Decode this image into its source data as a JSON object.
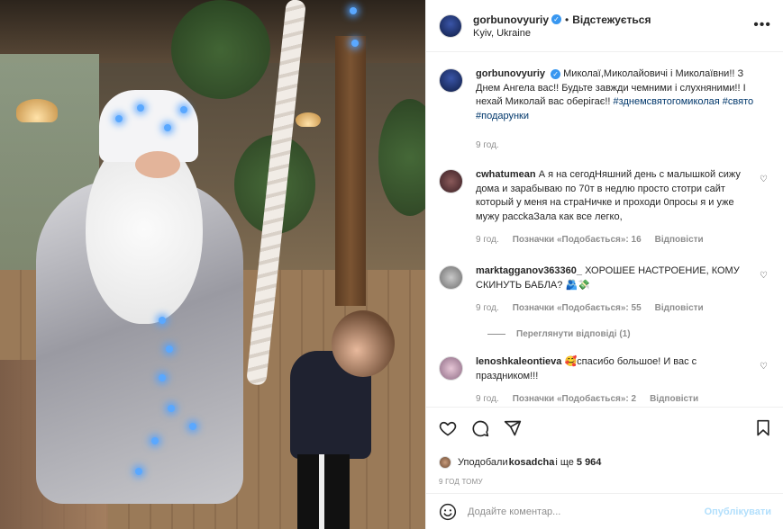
{
  "post": {
    "author": "gorbunovyuriy",
    "follow_label": "Відстежується",
    "location": "Kyiv, Ukraine"
  },
  "caption": {
    "author": "gorbunovyuriy",
    "text": "Миколаї,Миколайовичі і Миколаївни!! З Днем Ангела вас!! Будьте завжди чемними і слухняними!! І нехай Миколай вас оберігає!! ",
    "hashtags": "#зднемсвятогомиколая #свято #подарунки",
    "time": "9 год."
  },
  "comments": [
    {
      "author": "cwhatumean",
      "text": "А я на сегодНяшний день с малышкой сижу дома и зарабываю по 70т в недлю просто стотри сайт который у меня на страНичке и проходи 0просы я и уже мужу рассkаЗала как все легко,",
      "time": "9 год.",
      "likes": "Позначки «Подобається»: 16",
      "reply": "Відповісти"
    },
    {
      "author": "marktagganov363360_",
      "text": "ХОРОШЕЕ НАСТРОЕНИЕ, КОМУ СКИНУТЬ БАБЛА? 🫂💸",
      "time": "9 год.",
      "likes": "Позначки «Подобається»: 55",
      "reply": "Відповісти",
      "view_replies": "Переглянути відповіді (1)"
    },
    {
      "author": "lenoshkaleontieva",
      "text": "🥰спасибо большое! И вас с праздником!!!",
      "time": "9 год.",
      "likes": "Позначки «Подобається»: 2",
      "reply": "Відповісти"
    }
  ],
  "likes": {
    "prefix": "Уподобали ",
    "user": "kosadcha",
    "middle": " і ще ",
    "count": "5 964"
  },
  "ago": "9 год тому",
  "composer": {
    "placeholder": "Додайте коментар...",
    "publish": "Опублікувати"
  },
  "colors": {
    "link": "#00376b",
    "muted": "#8e8e8e",
    "verified": "#3897f0",
    "publish_disabled": "#b2dffc"
  }
}
